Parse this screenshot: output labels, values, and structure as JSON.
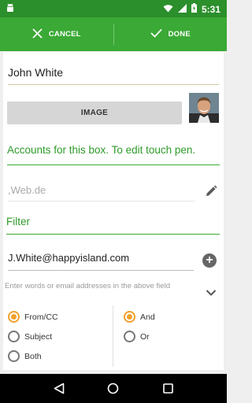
{
  "status_bar": {
    "time": "5:31",
    "icons": [
      "android-icon",
      "wifi-icon",
      "signal-icon",
      "battery-icon"
    ]
  },
  "action_bar": {
    "cancel_label": "CANCEL",
    "done_label": "DONE"
  },
  "form": {
    "name_value": "John White",
    "image_button_label": "IMAGE",
    "accounts_text": "Accounts for this box. To edit touch pen.",
    "domain_value": ",Web.de",
    "filter_label": "Filter",
    "email_value": "J.White@happyisland.com",
    "hint_text": "Enter words or email addresses in the above field"
  },
  "options": {
    "left": [
      {
        "label": "From/CC",
        "selected": true
      },
      {
        "label": "Subject",
        "selected": false
      },
      {
        "label": "Both",
        "selected": false
      }
    ],
    "right": [
      {
        "label": "And",
        "selected": true
      },
      {
        "label": "Or",
        "selected": false
      }
    ]
  },
  "colors": {
    "status_bar": "#2b8f2b",
    "action_bar": "#3aa935",
    "accent_green": "#2e9a2a",
    "radio_selected": "#f1a12a"
  }
}
